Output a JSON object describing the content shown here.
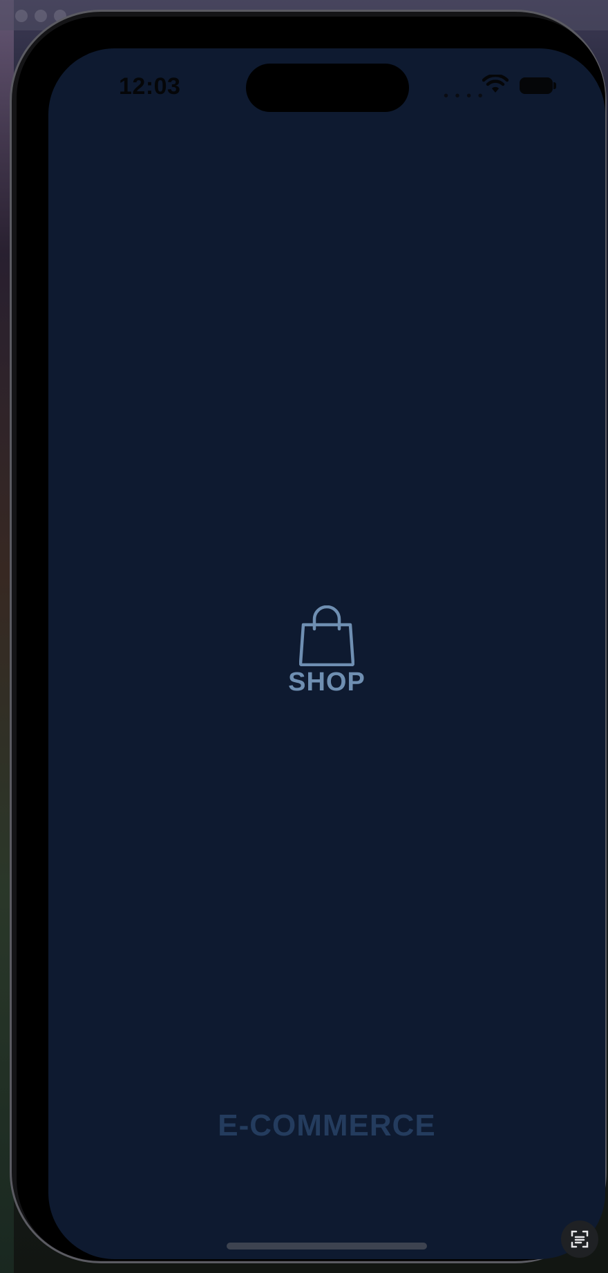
{
  "status_bar": {
    "time": "12:03",
    "signal_icon": "cellular-dots-icon",
    "wifi_icon": "wifi-icon",
    "battery_icon": "battery-icon"
  },
  "splash": {
    "logo_icon": "shopping-bag-icon",
    "logo_label": "SHOP",
    "brand_text": "E-COMMERCE"
  },
  "colors": {
    "screen_background": "#0e1a30",
    "logo_color": "#6f8fb2",
    "brand_color": "#243c5e"
  },
  "overlay": {
    "capture_icon": "live-text-scan-icon"
  }
}
